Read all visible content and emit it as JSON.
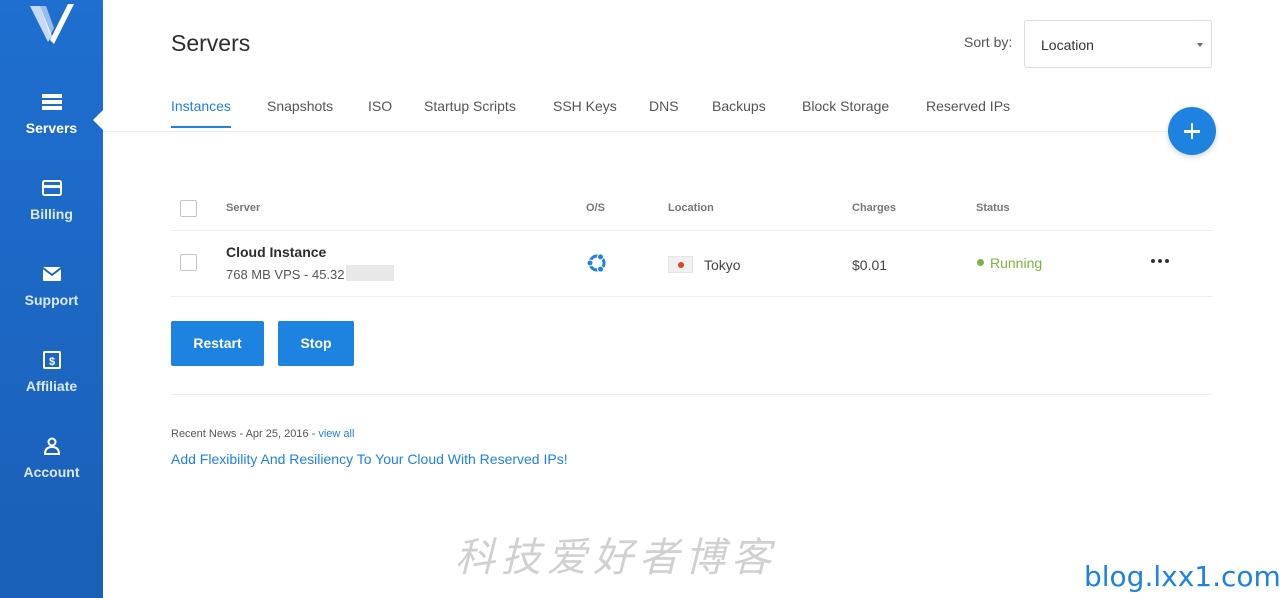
{
  "sidebar": {
    "items": [
      {
        "label": "Servers",
        "icon": "servers-icon",
        "active": true
      },
      {
        "label": "Billing",
        "icon": "billing-icon",
        "active": false
      },
      {
        "label": "Support",
        "icon": "mail-icon",
        "active": false
      },
      {
        "label": "Affiliate",
        "icon": "dollar-icon",
        "active": false
      },
      {
        "label": "Account",
        "icon": "user-icon",
        "active": false
      }
    ]
  },
  "header": {
    "title": "Servers",
    "sort_label": "Sort by:",
    "sort_value": "Location"
  },
  "tabs": [
    "Instances",
    "Snapshots",
    "ISO",
    "Startup Scripts",
    "SSH Keys",
    "DNS",
    "Backups",
    "Block Storage",
    "Reserved IPs"
  ],
  "table": {
    "columns": [
      "Server",
      "O/S",
      "Location",
      "Charges",
      "Status"
    ],
    "rows": [
      {
        "name": "Cloud Instance",
        "sub": "768 MB VPS - 45.32",
        "os_icon": "ubuntu-icon",
        "location": "Tokyo",
        "flag": "japan-flag-icon",
        "charges": "$0.01",
        "status": "Running"
      }
    ]
  },
  "actions": {
    "restart": "Restart",
    "stop": "Stop"
  },
  "news": {
    "meta": "Recent News - Apr 25, 2016 - ",
    "view_all": "view all",
    "headline": "Add Flexibility And Resiliency To Your Cloud With Reserved IPs!"
  },
  "watermark": {
    "cn": "科技爱好者博客",
    "site": "blog.lxx1.com"
  },
  "colors": {
    "accent": "#1e82e0",
    "sidebar": "#1e6fd0",
    "running": "#7cb342"
  }
}
